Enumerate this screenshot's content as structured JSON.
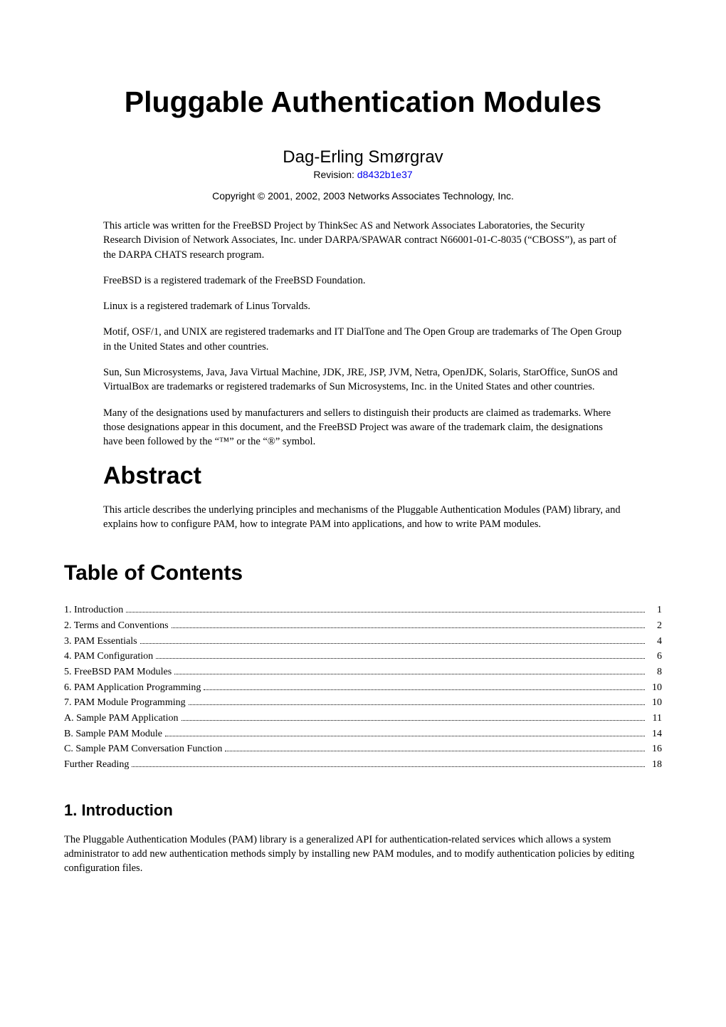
{
  "title": "Pluggable Authentication Modules",
  "author": "Dag-Erling Smørgrav",
  "revision_label": "Revision: ",
  "revision_id": "d8432b1e37",
  "copyright": "Copyright © 2001, 2002, 2003 Networks Associates Technology, Inc.",
  "notices": [
    "This article was written for the FreeBSD Project by ThinkSec AS and Network Associates Laboratories, the Security Research Division of Network Associates, Inc. under DARPA/SPAWAR contract N66001-01-C-8035 (“CBOSS”), as part of the DARPA CHATS research program.",
    "FreeBSD is a registered trademark of the FreeBSD Foundation.",
    "Linux is a registered trademark of Linus Torvalds.",
    "Motif, OSF/1, and UNIX are registered trademarks and IT DialTone and The Open Group are trademarks of The Open Group in the United States and other countries.",
    "Sun, Sun Microsystems, Java, Java Virtual Machine, JDK, JRE, JSP, JVM, Netra, OpenJDK, Solaris, StarOffice, SunOS and VirtualBox are trademarks or registered trademarks of Sun Microsystems, Inc. in the United States and other countries.",
    "Many of the designations used by manufacturers and sellers to distinguish their products are claimed as trademarks. Where those designations appear in this document, and the FreeBSD Project was aware of the trademark claim, the designations have been followed by the “™” or the “®” symbol."
  ],
  "abstract": {
    "heading": "Abstract",
    "text": "This article describes the underlying principles and mechanisms of the Pluggable Authentication Modules (PAM) library, and explains how to configure PAM, how to integrate PAM into applications, and how to write PAM modules."
  },
  "toc": {
    "heading": "Table of Contents",
    "items": [
      {
        "label": "1. Introduction",
        "page": "1"
      },
      {
        "label": "2. Terms and Conventions",
        "page": "2"
      },
      {
        "label": "3. PAM Essentials",
        "page": "4"
      },
      {
        "label": "4. PAM Configuration",
        "page": "6"
      },
      {
        "label": "5. FreeBSD PAM Modules",
        "page": "8"
      },
      {
        "label": "6. PAM Application Programming",
        "page": "10"
      },
      {
        "label": "7. PAM Module Programming",
        "page": "10"
      },
      {
        "label": "A. Sample PAM Application",
        "page": "11"
      },
      {
        "label": "B. Sample PAM Module",
        "page": "14"
      },
      {
        "label": "C. Sample PAM Conversation Function",
        "page": "16"
      },
      {
        "label": "Further Reading",
        "page": "18"
      }
    ]
  },
  "section1": {
    "heading": "1. Introduction",
    "text": "The Pluggable Authentication Modules (PAM) library is a generalized API for authentication-related services which allows a system administrator to add new authentication methods simply by installing new PAM modules, and to modify authentication policies by editing configuration files."
  }
}
